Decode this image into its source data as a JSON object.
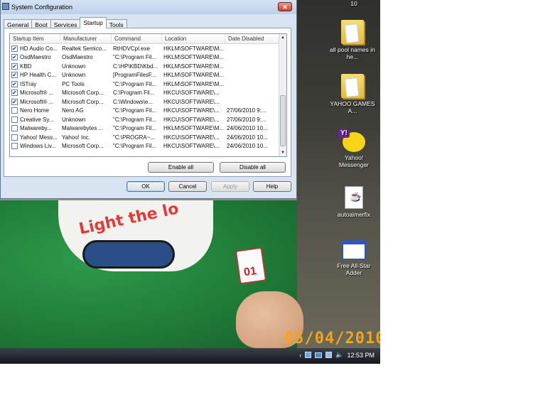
{
  "window": {
    "title": "System Configuration",
    "close_glyph": "✕",
    "tabs": [
      {
        "label": "General",
        "active": false
      },
      {
        "label": "Boot",
        "active": false
      },
      {
        "label": "Services",
        "active": false
      },
      {
        "label": "Startup",
        "active": true
      },
      {
        "label": "Tools",
        "active": false
      }
    ],
    "columns": [
      "Startup Item",
      "Manufacturer",
      "Command",
      "Location",
      "Date Disabled"
    ],
    "rows": [
      {
        "checked": true,
        "item": "HD Audio Co...",
        "manufacturer": "Realtek Semico...",
        "command": "RtHDVCpl.exe",
        "location": "HKLM\\SOFTWARE\\M...",
        "date_disabled": ""
      },
      {
        "checked": true,
        "item": "OsdMaestro",
        "manufacturer": "OsdMaestro",
        "command": "\"C:\\Program Fil...",
        "location": "HKLM\\SOFTWARE\\M...",
        "date_disabled": ""
      },
      {
        "checked": true,
        "item": "KBD",
        "manufacturer": "Unknown",
        "command": "C:\\HP\\KBD\\Kbd...",
        "location": "HKLM\\SOFTWARE\\M...",
        "date_disabled": ""
      },
      {
        "checked": true,
        "item": "HP Health C...",
        "manufacturer": "Unknown",
        "command": "[ProgramFilesF...",
        "location": "HKLM\\SOFTWARE\\M...",
        "date_disabled": ""
      },
      {
        "checked": true,
        "item": "ISTray",
        "manufacturer": "PC Tools",
        "command": "\"C:\\Program Fil...",
        "location": "HKLM\\SOFTWARE\\M...",
        "date_disabled": ""
      },
      {
        "checked": true,
        "item": "Microsoft® ...",
        "manufacturer": "Microsoft Corp...",
        "command": "C:\\Program Fil...",
        "location": "HKCU\\SOFTWARE\\...",
        "date_disabled": ""
      },
      {
        "checked": true,
        "item": "Microsoft® ...",
        "manufacturer": "Microsoft Corp...",
        "command": "C:\\Windows\\e...",
        "location": "HKCU\\SOFTWARE\\...",
        "date_disabled": ""
      },
      {
        "checked": false,
        "item": "Nero Home",
        "manufacturer": "Nero AG",
        "command": "\"C:\\Program Fil...",
        "location": "HKCU\\SOFTWARE\\...",
        "date_disabled": "27/06/2010 9:..."
      },
      {
        "checked": false,
        "item": "Creative Sy...",
        "manufacturer": "Unknown",
        "command": "\"C:\\Program Fil...",
        "location": "HKCU\\SOFTWARE\\...",
        "date_disabled": "27/06/2010 9:..."
      },
      {
        "checked": false,
        "item": "Malwareby...",
        "manufacturer": "Malwarebytes ...",
        "command": "\"C:\\Program Fil...",
        "location": "HKLM\\SOFTWARE\\M...",
        "date_disabled": "24/06/2010 10..."
      },
      {
        "checked": false,
        "item": "Yahoo! Mess...",
        "manufacturer": "Yahoo! Inc.",
        "command": "\"C:\\PROGRA~...",
        "location": "HKCU\\SOFTWARE\\...",
        "date_disabled": "24/06/2010 10..."
      },
      {
        "checked": false,
        "item": "Windows Liv...",
        "manufacturer": "Microsoft Corp...",
        "command": "\"C:\\Program Fil...",
        "location": "HKCU\\SOFTWARE\\...",
        "date_disabled": "24/06/2010 10..."
      }
    ],
    "enable_all_label": "Enable all",
    "disable_all_label": "Disable all",
    "ok_label": "OK",
    "cancel_label": "Cancel",
    "apply_label": "Apply",
    "help_label": "Help"
  },
  "desktop": {
    "top_label": "10",
    "icons": [
      {
        "label": "all pool names in he...",
        "icon": "folder-icon"
      },
      {
        "label": "YAHOO GAMES A...",
        "icon": "folder-icon"
      },
      {
        "label": "Yahoo! Messenger",
        "icon": "yahoo-messenger-icon"
      },
      {
        "label": "autoaimerfix",
        "icon": "java-file-icon"
      },
      {
        "label": "Free All-Star Adder",
        "icon": "application-window-icon"
      }
    ],
    "photo_date_stamp": "05/04/2010",
    "photo_shirt_text": "Light the lo",
    "photo_badge_number": "01"
  },
  "taskbar": {
    "tray_chevron": "‹",
    "clock": "12:53 PM"
  }
}
